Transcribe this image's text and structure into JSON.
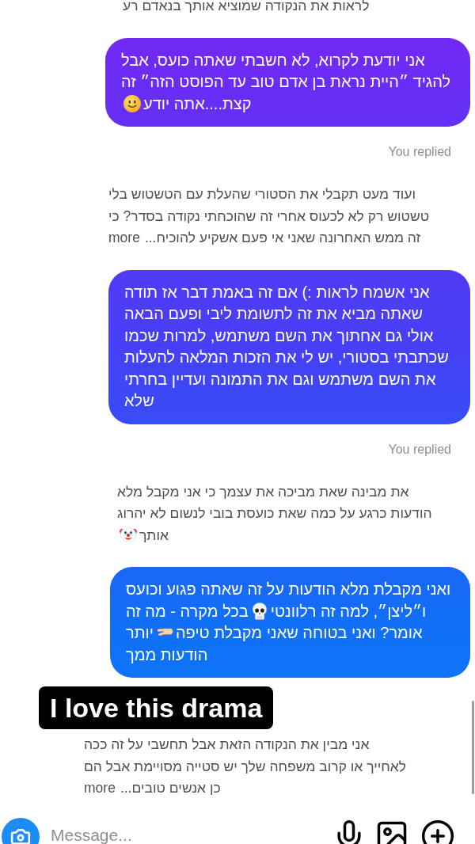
{
  "thread": [
    {
      "kind": "received",
      "parts": [
        {
          "kind": "text",
          "text": "לראות את הנקודה שמוציא אותך בנאדם רע"
        }
      ]
    },
    {
      "kind": "sent",
      "parts": [
        {
          "kind": "text",
          "text": "אני יודעת לקרוא, לא חשבתי שאתה כועס, אבל להגיד ״היית נראת בן אדם טוב עד הפוסט הזה״ זה קצת....אתה יודע"
        },
        {
          "kind": "smile"
        }
      ]
    },
    {
      "kind": "status",
      "text": "You replied"
    },
    {
      "kind": "received",
      "parts": [
        {
          "kind": "text",
          "text": "ועוד מעט תקבלי את הסטורי שהעלת עם הטשטוש בלי טשטוש רק לא לכעוס אחרי זה שהוכחתי נקודה בסדר? כי זה ממש האחרונה שאני אי פעם אשקיע להוכיח..."
        }
      ],
      "more": "more"
    },
    {
      "kind": "sent",
      "parts": [
        {
          "kind": "text",
          "text": "אני אשמח לראות :) אם זה באמת דבר אז תודה שאתה מביא את זה לתשומת ליבי ופעם הבאה אולי גם אחתוך את השם משתמש, למרות שכמו שכתבתי בסטורי, יש לי את הזכות המלאה להעלות את השם משתמש וגם את התמונה ועדיין בחרתי שלא"
        }
      ]
    },
    {
      "kind": "status",
      "text": "You replied"
    },
    {
      "kind": "received",
      "parts": [
        {
          "kind": "text",
          "text": "את מבינה שאת מביכה את עצמך כי אני מקבל מלא הודעות כרגע על כמה שאת כועסת בובי לנשום לא יהרוג אותך"
        },
        {
          "kind": "clown"
        }
      ]
    },
    {
      "kind": "sent",
      "parts": [
        {
          "kind": "text",
          "text": "ואני מקבלת מלא הודעות על זה שאתה פגוע וכועס ו״ליצן״, למה זה רלוונטי"
        },
        {
          "kind": "skull"
        },
        {
          "kind": "text",
          "text": "בכל מקרה - מה זה אומר? ואני בטוחה שאני מקבלת טיפה"
        },
        {
          "kind": "pinch"
        },
        {
          "kind": "text",
          "text": "יותר הודעות ממך"
        }
      ]
    },
    {
      "kind": "sticker",
      "text": "I love this drama"
    },
    {
      "kind": "received",
      "parts": [
        {
          "kind": "text",
          "text": "אני מבין את הנקודה הזאת אבל תחשבי על זה ככה לאחייך או קרוב משפחה שלך יש סטייה מסויימת אבל הם כן אנשים טובים..."
        }
      ],
      "more": "more"
    }
  ],
  "composer": {
    "placeholder": "Message..."
  }
}
